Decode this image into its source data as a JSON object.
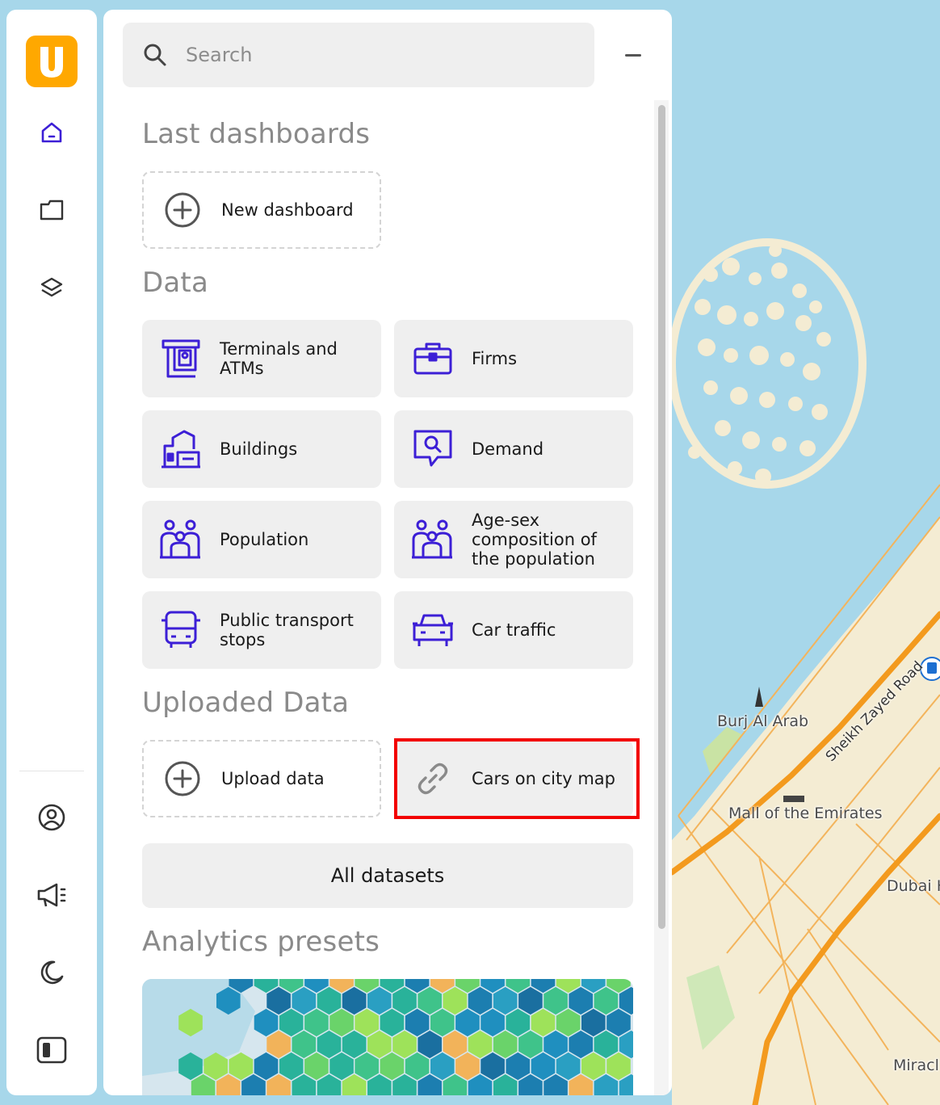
{
  "colors": {
    "brand": "#ffa800",
    "accent": "#3c1fd6",
    "highlight_border": "#f20000",
    "sea": "#a7d7ea",
    "land": "#f4ecd3",
    "road": "#f39a1e"
  },
  "nav": {
    "logo_letter": "U",
    "items": [
      {
        "icon": "home-icon"
      },
      {
        "icon": "folder-icon"
      },
      {
        "icon": "layers-icon"
      },
      {
        "icon": "user-circle-icon"
      },
      {
        "icon": "megaphone-icon"
      },
      {
        "icon": "moon-icon"
      },
      {
        "icon": "panel-toggle-icon"
      }
    ]
  },
  "search": {
    "placeholder": "Search",
    "value": "",
    "icon": "search-icon"
  },
  "collapse_icon": "minus-icon",
  "sections": {
    "last_dashboards": "Last dashboards",
    "data": "Data",
    "uploaded_data": "Uploaded Data",
    "analytics_presets": "Analytics presets"
  },
  "dashboards": {
    "new_dashboard": "New dashboard"
  },
  "data_cards": [
    {
      "label": "Terminals and ATMs",
      "icon": "atm-terminal-icon"
    },
    {
      "label": "Firms",
      "icon": "briefcase-icon"
    },
    {
      "label": "Buildings",
      "icon": "buildings-icon"
    },
    {
      "label": "Demand",
      "icon": "search-bubble-icon"
    },
    {
      "label": "Population",
      "icon": "people-icon"
    },
    {
      "label": "Age-sex composition of the population",
      "icon": "people-icon"
    },
    {
      "label": "Public transport stops",
      "icon": "bus-icon"
    },
    {
      "label": "Car traffic",
      "icon": "car-icon"
    }
  ],
  "uploaded": {
    "upload_data": "Upload data",
    "cars_on_city_map": "Cars on city map"
  },
  "all_datasets": "All datasets",
  "map": {
    "labels": {
      "burj_al_arab": "Burj Al Arab",
      "mall_of_the_emirates": "Mall of the Emirates",
      "dubai_h": "Dubai H",
      "miracl": "Miracl",
      "sheikh_zayed_road": "Sheikh Zayed Road"
    }
  }
}
